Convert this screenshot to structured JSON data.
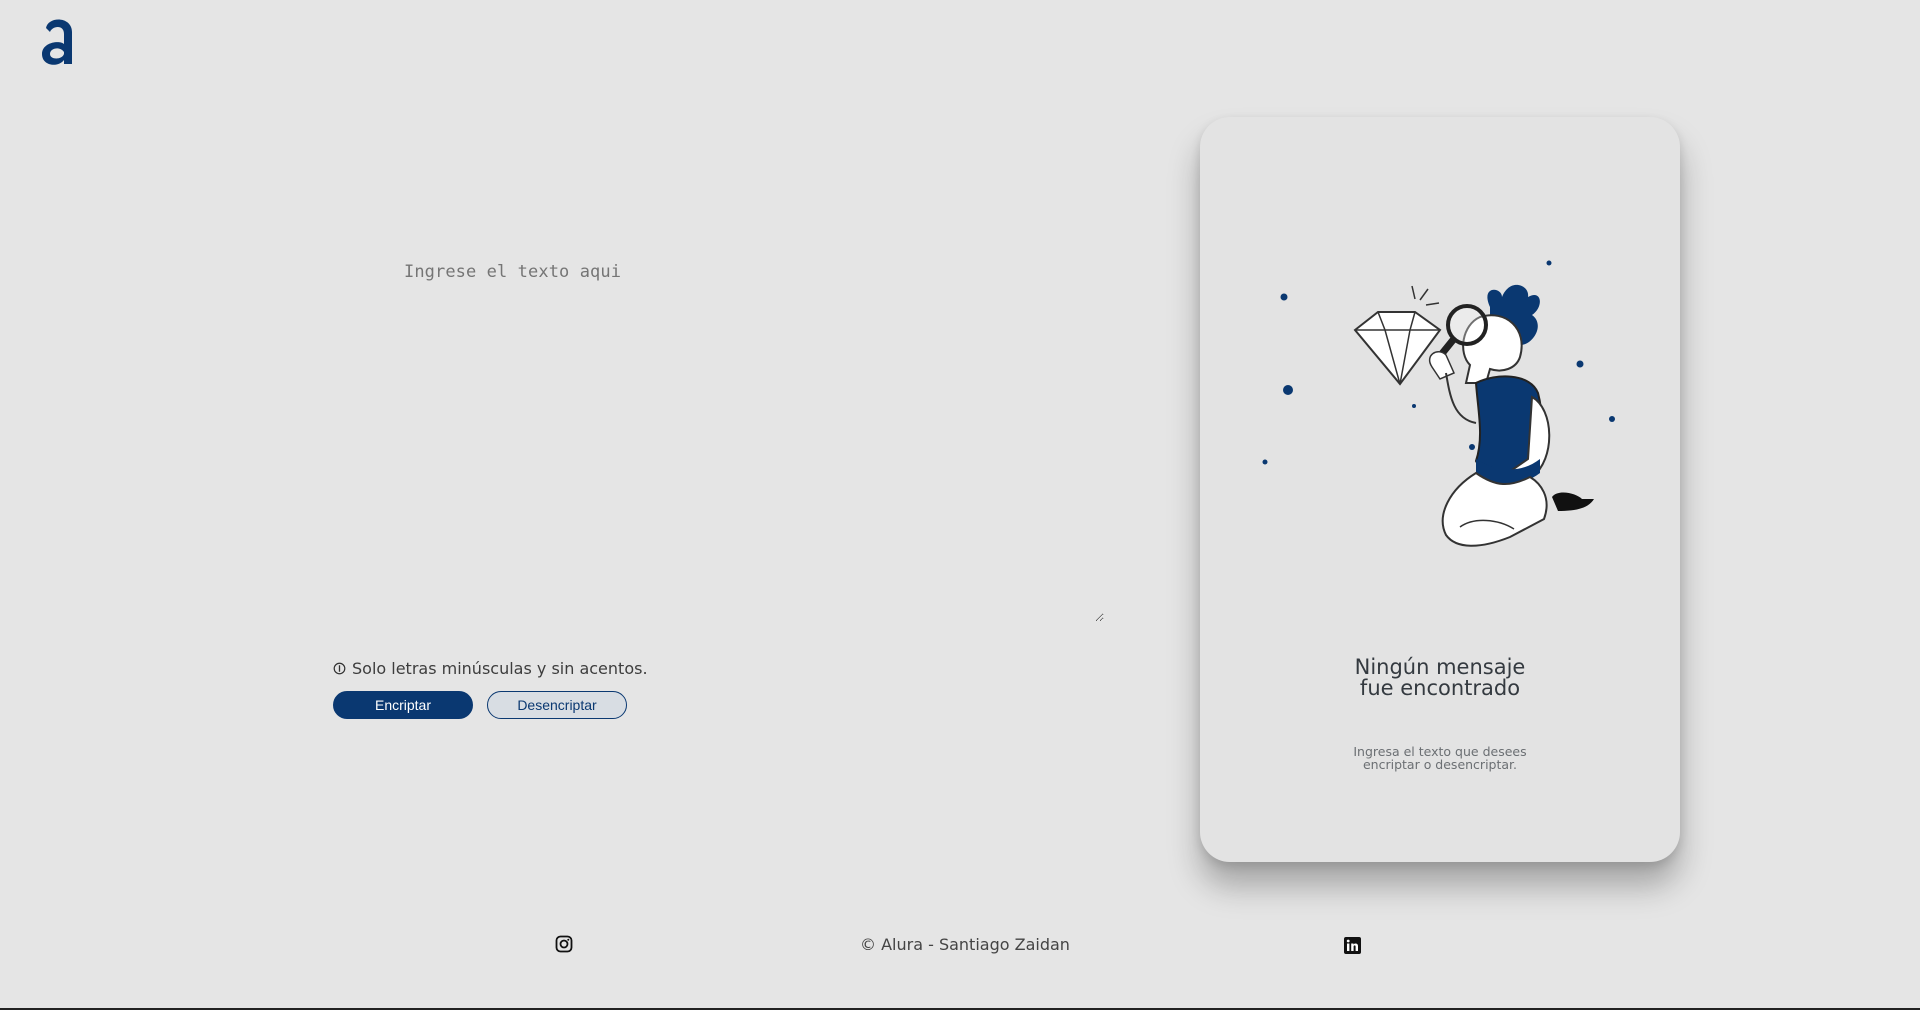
{
  "header": {
    "logo_icon": "alura-logo-icon"
  },
  "editor": {
    "placeholder": "Ingrese el texto aqui"
  },
  "hint": {
    "icon": "info-icon",
    "text": "Solo letras minúsculas y sin acentos."
  },
  "actions": {
    "encrypt_label": "Encriptar",
    "decrypt_label": "Desencriptar"
  },
  "result_panel": {
    "illustration": "person-magnifier-diamond-illustration",
    "title": "Ningún mensaje fue encontrado",
    "subtitle": "Ingresa el texto que desees encriptar o desencriptar."
  },
  "footer": {
    "instagram_icon": "instagram-icon",
    "copyright": "© Alura - Santiago Zaidan",
    "linkedin_icon": "linkedin-icon"
  },
  "colors": {
    "accent": "#0a3871",
    "background": "#e5e5e5"
  }
}
